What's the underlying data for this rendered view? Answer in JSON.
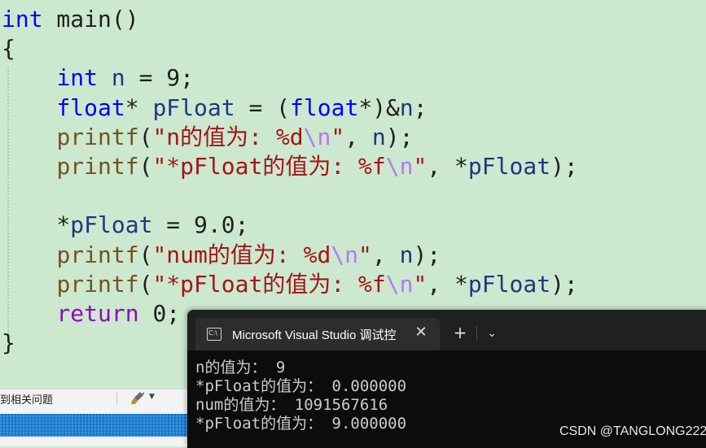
{
  "editor": {
    "lines": [
      [
        {
          "t": "int",
          "c": "kw"
        },
        {
          "t": " main()",
          "c": "punc"
        }
      ],
      [
        {
          "t": "{",
          "c": "punc"
        }
      ],
      [
        {
          "t": "    ",
          "c": "punc"
        },
        {
          "t": "int",
          "c": "kw"
        },
        {
          "t": " ",
          "c": "punc"
        },
        {
          "t": "n",
          "c": "ident"
        },
        {
          "t": " = 9;",
          "c": "punc"
        }
      ],
      [
        {
          "t": "    ",
          "c": "punc"
        },
        {
          "t": "float",
          "c": "kw"
        },
        {
          "t": "* ",
          "c": "punc"
        },
        {
          "t": "pFloat",
          "c": "ident"
        },
        {
          "t": " = (",
          "c": "punc"
        },
        {
          "t": "float",
          "c": "kw"
        },
        {
          "t": "*)&",
          "c": "punc"
        },
        {
          "t": "n",
          "c": "ident"
        },
        {
          "t": ";",
          "c": "punc"
        }
      ],
      [
        {
          "t": "    ",
          "c": "punc"
        },
        {
          "t": "printf",
          "c": "func"
        },
        {
          "t": "(",
          "c": "punc"
        },
        {
          "t": "\"n的值为: %d",
          "c": "str"
        },
        {
          "t": "\\n",
          "c": "esc"
        },
        {
          "t": "\"",
          "c": "str"
        },
        {
          "t": ", ",
          "c": "punc"
        },
        {
          "t": "n",
          "c": "ident"
        },
        {
          "t": ");",
          "c": "punc"
        }
      ],
      [
        {
          "t": "    ",
          "c": "punc"
        },
        {
          "t": "printf",
          "c": "func"
        },
        {
          "t": "(",
          "c": "punc"
        },
        {
          "t": "\"*pFloat的值为: %f",
          "c": "str"
        },
        {
          "t": "\\n",
          "c": "esc"
        },
        {
          "t": "\"",
          "c": "str"
        },
        {
          "t": ", *",
          "c": "punc"
        },
        {
          "t": "pFloat",
          "c": "ident"
        },
        {
          "t": ");",
          "c": "punc"
        }
      ],
      [],
      [
        {
          "t": "    *",
          "c": "punc"
        },
        {
          "t": "pFloat",
          "c": "ident"
        },
        {
          "t": " = 9.0;",
          "c": "punc"
        }
      ],
      [
        {
          "t": "    ",
          "c": "punc"
        },
        {
          "t": "printf",
          "c": "func"
        },
        {
          "t": "(",
          "c": "punc"
        },
        {
          "t": "\"num的值为: %d",
          "c": "str"
        },
        {
          "t": "\\n",
          "c": "esc"
        },
        {
          "t": "\"",
          "c": "str"
        },
        {
          "t": ", ",
          "c": "punc"
        },
        {
          "t": "n",
          "c": "ident"
        },
        {
          "t": ");",
          "c": "punc"
        }
      ],
      [
        {
          "t": "    ",
          "c": "punc"
        },
        {
          "t": "printf",
          "c": "func"
        },
        {
          "t": "(",
          "c": "punc"
        },
        {
          "t": "\"*pFloat的值为: %f",
          "c": "str"
        },
        {
          "t": "\\n",
          "c": "esc"
        },
        {
          "t": "\"",
          "c": "str"
        },
        {
          "t": ", *",
          "c": "punc"
        },
        {
          "t": "pFloat",
          "c": "ident"
        },
        {
          "t": ");",
          "c": "punc"
        }
      ],
      [
        {
          "t": "    ",
          "c": "punc"
        },
        {
          "t": "return",
          "c": "ctrl"
        },
        {
          "t": " 0;",
          "c": "punc"
        }
      ],
      [
        {
          "t": "}",
          "c": "punc"
        }
      ]
    ]
  },
  "error_list": {
    "label": "到相关问题"
  },
  "console": {
    "tab_title": "Microsoft Visual Studio 调试控",
    "tab_icon_text": "C:\\",
    "close_glyph": "✕",
    "new_tab_glyph": "+",
    "dropdown_glyph": "⌄",
    "output_lines": [
      "n的值为： 9",
      "*pFloat的值为： 0.000000",
      "num的值为： 1091567616",
      "*pFloat的值为： 9.000000"
    ]
  },
  "watermark": "CSDN @TANGLONG222",
  "colors": {
    "editor_bg": "#cce8cf",
    "keyword": "#0000ff",
    "identifier": "#1f377f",
    "function": "#74531f",
    "string": "#a31515",
    "escape": "#b776fb",
    "control": "#8f08c4",
    "console_bg": "#0c0c0c",
    "console_text": "#cccccc"
  }
}
